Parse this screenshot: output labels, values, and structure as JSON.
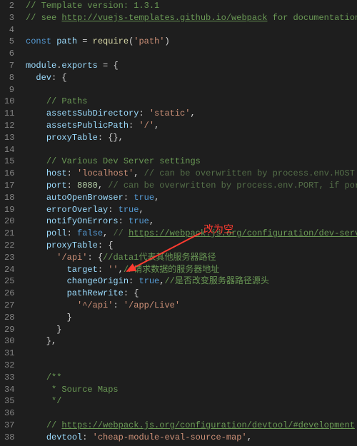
{
  "annotation": "改为空",
  "lines": [
    {
      "n": 2,
      "segs": [
        {
          "cls": "c-comment",
          "t": "// Template version: 1.3.1"
        }
      ]
    },
    {
      "n": 3,
      "segs": [
        {
          "cls": "c-comment",
          "t": "// see "
        },
        {
          "cls": "c-link",
          "t": "http://vuejs-templates.github.io/webpack"
        },
        {
          "cls": "c-comment",
          "t": " for documentation."
        }
      ]
    },
    {
      "n": 4,
      "segs": []
    },
    {
      "n": 5,
      "segs": [
        {
          "cls": "c-keyword",
          "t": "const"
        },
        {
          "cls": "c-punct",
          "t": " "
        },
        {
          "cls": "c-ident",
          "t": "path"
        },
        {
          "cls": "c-punct",
          "t": " = "
        },
        {
          "cls": "c-func",
          "t": "require"
        },
        {
          "cls": "c-punct",
          "t": "("
        },
        {
          "cls": "c-string",
          "t": "'path'"
        },
        {
          "cls": "c-punct",
          "t": ")"
        }
      ]
    },
    {
      "n": 6,
      "segs": []
    },
    {
      "n": 7,
      "segs": [
        {
          "cls": "c-ident",
          "t": "module"
        },
        {
          "cls": "c-punct",
          "t": "."
        },
        {
          "cls": "c-ident",
          "t": "exports"
        },
        {
          "cls": "c-punct",
          "t": " = {"
        }
      ]
    },
    {
      "n": 8,
      "segs": [
        {
          "cls": "c-punct",
          "t": "  "
        },
        {
          "cls": "c-ident",
          "t": "dev"
        },
        {
          "cls": "c-punct",
          "t": ": {"
        }
      ]
    },
    {
      "n": 9,
      "segs": []
    },
    {
      "n": 10,
      "segs": [
        {
          "cls": "c-punct",
          "t": "    "
        },
        {
          "cls": "c-comment",
          "t": "// Paths"
        }
      ]
    },
    {
      "n": 11,
      "segs": [
        {
          "cls": "c-punct",
          "t": "    "
        },
        {
          "cls": "c-ident",
          "t": "assetsSubDirectory"
        },
        {
          "cls": "c-punct",
          "t": ": "
        },
        {
          "cls": "c-string",
          "t": "'static'"
        },
        {
          "cls": "c-punct",
          "t": ","
        }
      ]
    },
    {
      "n": 12,
      "segs": [
        {
          "cls": "c-punct",
          "t": "    "
        },
        {
          "cls": "c-ident",
          "t": "assetsPublicPath"
        },
        {
          "cls": "c-punct",
          "t": ": "
        },
        {
          "cls": "c-string",
          "t": "'/'"
        },
        {
          "cls": "c-punct",
          "t": ","
        }
      ]
    },
    {
      "n": 13,
      "segs": [
        {
          "cls": "c-punct",
          "t": "    "
        },
        {
          "cls": "c-ident",
          "t": "proxyTable"
        },
        {
          "cls": "c-punct",
          "t": ": {},"
        }
      ]
    },
    {
      "n": 14,
      "segs": []
    },
    {
      "n": 15,
      "segs": [
        {
          "cls": "c-punct",
          "t": "    "
        },
        {
          "cls": "c-comment",
          "t": "// Various Dev Server settings"
        }
      ]
    },
    {
      "n": 16,
      "segs": [
        {
          "cls": "c-punct",
          "t": "    "
        },
        {
          "cls": "c-ident",
          "t": "host"
        },
        {
          "cls": "c-punct",
          "t": ": "
        },
        {
          "cls": "c-string",
          "t": "'localhost'"
        },
        {
          "cls": "c-punct",
          "t": ", "
        },
        {
          "cls": "c-comment-dim",
          "t": "// can be overwritten by process.env.HOST"
        }
      ]
    },
    {
      "n": 17,
      "segs": [
        {
          "cls": "c-punct",
          "t": "    "
        },
        {
          "cls": "c-ident",
          "t": "port"
        },
        {
          "cls": "c-punct",
          "t": ": "
        },
        {
          "cls": "c-number",
          "t": "8080"
        },
        {
          "cls": "c-punct",
          "t": ", "
        },
        {
          "cls": "c-comment-dim",
          "t": "// can be overwritten by process.env.PORT, if port"
        }
      ]
    },
    {
      "n": 18,
      "segs": [
        {
          "cls": "c-punct",
          "t": "    "
        },
        {
          "cls": "c-ident",
          "t": "autoOpenBrowser"
        },
        {
          "cls": "c-punct",
          "t": ": "
        },
        {
          "cls": "c-const",
          "t": "true"
        },
        {
          "cls": "c-punct",
          "t": ","
        }
      ]
    },
    {
      "n": 19,
      "segs": [
        {
          "cls": "c-punct",
          "t": "    "
        },
        {
          "cls": "c-ident",
          "t": "errorOverlay"
        },
        {
          "cls": "c-punct",
          "t": ": "
        },
        {
          "cls": "c-const",
          "t": "true"
        },
        {
          "cls": "c-punct",
          "t": ","
        }
      ]
    },
    {
      "n": 20,
      "segs": [
        {
          "cls": "c-punct",
          "t": "    "
        },
        {
          "cls": "c-ident",
          "t": "notifyOnErrors"
        },
        {
          "cls": "c-punct",
          "t": ": "
        },
        {
          "cls": "c-const",
          "t": "true"
        },
        {
          "cls": "c-punct",
          "t": ","
        }
      ]
    },
    {
      "n": 21,
      "segs": [
        {
          "cls": "c-punct",
          "t": "    "
        },
        {
          "cls": "c-ident",
          "t": "poll"
        },
        {
          "cls": "c-punct",
          "t": ": "
        },
        {
          "cls": "c-const",
          "t": "false"
        },
        {
          "cls": "c-punct",
          "t": ", "
        },
        {
          "cls": "c-comment-dim",
          "t": "// "
        },
        {
          "cls": "c-link",
          "t": "https://webpack.js.org/configuration/dev-serve"
        }
      ]
    },
    {
      "n": 22,
      "segs": [
        {
          "cls": "c-punct",
          "t": "    "
        },
        {
          "cls": "c-ident",
          "t": "proxyTable"
        },
        {
          "cls": "c-punct",
          "t": ": {"
        }
      ]
    },
    {
      "n": 23,
      "segs": [
        {
          "cls": "c-punct",
          "t": "      "
        },
        {
          "cls": "c-string",
          "t": "'/api'"
        },
        {
          "cls": "c-punct",
          "t": ": {"
        },
        {
          "cls": "c-comment",
          "t": "//data1代表其他服务器路径"
        }
      ]
    },
    {
      "n": 24,
      "segs": [
        {
          "cls": "c-punct",
          "t": "        "
        },
        {
          "cls": "c-ident",
          "t": "target"
        },
        {
          "cls": "c-punct",
          "t": ": "
        },
        {
          "cls": "c-string",
          "t": "''"
        },
        {
          "cls": "c-punct",
          "t": ","
        },
        {
          "cls": "c-comment",
          "t": "//请求数据的服务器地址"
        }
      ]
    },
    {
      "n": 25,
      "segs": [
        {
          "cls": "c-punct",
          "t": "        "
        },
        {
          "cls": "c-ident",
          "t": "changeOrigin"
        },
        {
          "cls": "c-punct",
          "t": ": "
        },
        {
          "cls": "c-const",
          "t": "true"
        },
        {
          "cls": "c-punct",
          "t": ","
        },
        {
          "cls": "c-comment",
          "t": "//是否改变服务器路径源头"
        }
      ]
    },
    {
      "n": 26,
      "segs": [
        {
          "cls": "c-punct",
          "t": "        "
        },
        {
          "cls": "c-ident",
          "t": "pathRewrite"
        },
        {
          "cls": "c-punct",
          "t": ": {"
        }
      ]
    },
    {
      "n": 27,
      "segs": [
        {
          "cls": "c-punct",
          "t": "          "
        },
        {
          "cls": "c-string",
          "t": "'^/api'"
        },
        {
          "cls": "c-punct",
          "t": ": "
        },
        {
          "cls": "c-string",
          "t": "'/app/Live'"
        }
      ]
    },
    {
      "n": 28,
      "segs": [
        {
          "cls": "c-punct",
          "t": "        }"
        }
      ]
    },
    {
      "n": 29,
      "segs": [
        {
          "cls": "c-punct",
          "t": "      }"
        }
      ]
    },
    {
      "n": 30,
      "segs": [
        {
          "cls": "c-punct",
          "t": "    },"
        }
      ]
    },
    {
      "n": 31,
      "segs": []
    },
    {
      "n": 32,
      "segs": []
    },
    {
      "n": 33,
      "segs": [
        {
          "cls": "c-punct",
          "t": "    "
        },
        {
          "cls": "c-comment",
          "t": "/**"
        }
      ]
    },
    {
      "n": 34,
      "segs": [
        {
          "cls": "c-punct",
          "t": "    "
        },
        {
          "cls": "c-comment",
          "t": " * Source Maps"
        }
      ]
    },
    {
      "n": 35,
      "segs": [
        {
          "cls": "c-punct",
          "t": "    "
        },
        {
          "cls": "c-comment",
          "t": " */"
        }
      ]
    },
    {
      "n": 36,
      "segs": []
    },
    {
      "n": 37,
      "segs": [
        {
          "cls": "c-punct",
          "t": "    "
        },
        {
          "cls": "c-comment",
          "t": "// "
        },
        {
          "cls": "c-link",
          "t": "https://webpack.js.org/configuration/devtool/#development"
        }
      ]
    },
    {
      "n": 38,
      "segs": [
        {
          "cls": "c-punct",
          "t": "    "
        },
        {
          "cls": "c-ident",
          "t": "devtool"
        },
        {
          "cls": "c-punct",
          "t": ": "
        },
        {
          "cls": "c-string",
          "t": "'cheap-module-eval-source-map'"
        },
        {
          "cls": "c-punct",
          "t": ","
        }
      ]
    }
  ]
}
